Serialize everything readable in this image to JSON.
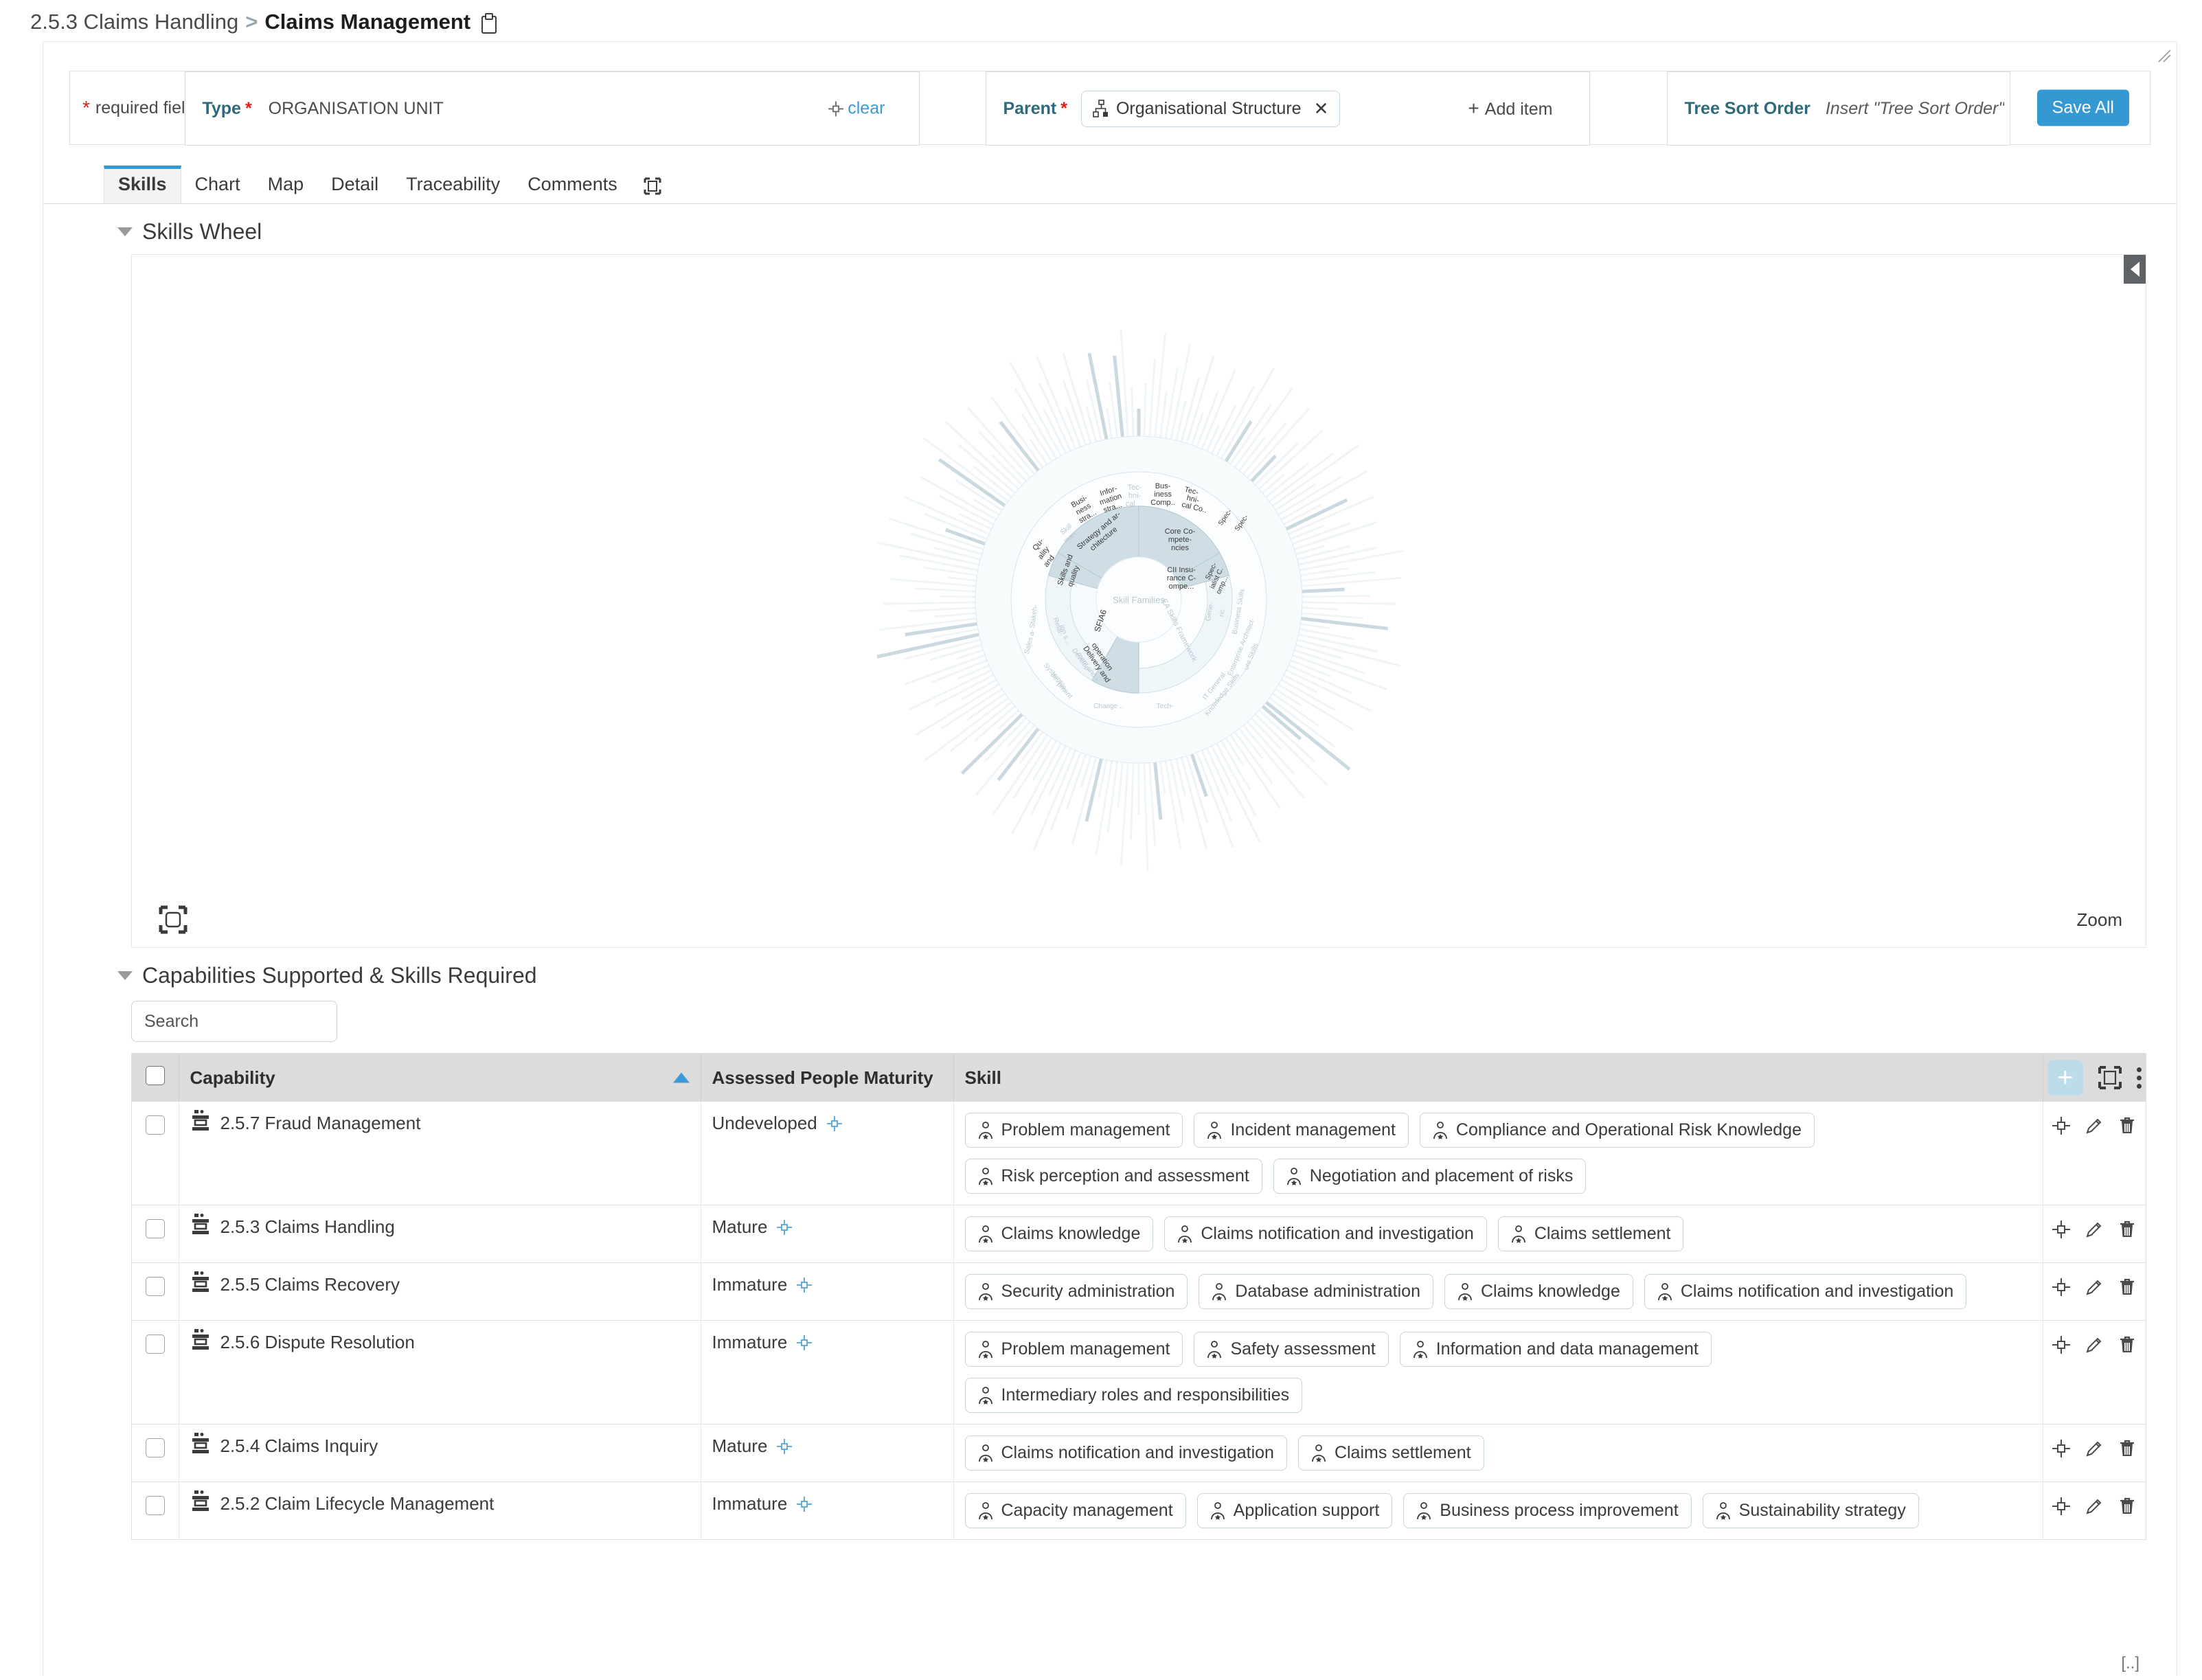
{
  "breadcrumb": {
    "parent": "2.5.3 Claims Handling",
    "separator": ">",
    "current": "Claims Management",
    "copy_icon": "clipboard-icon"
  },
  "form": {
    "required_note": "required field",
    "required_star": "*",
    "type": {
      "label": "Type",
      "star": "*",
      "value": "ORGANISATION UNIT",
      "clear_label": "clear"
    },
    "parent": {
      "label": "Parent",
      "star": "*",
      "chip": "Organisational Structure",
      "chip_remove": "✕",
      "add_item": "Add item",
      "add_plus": "+"
    },
    "tree_sort": {
      "label": "Tree Sort Order",
      "placeholder": "Insert \"Tree Sort Order\"",
      "value": ""
    },
    "save_all": "Save All"
  },
  "tabs": [
    {
      "label": "Skills",
      "active": true
    },
    {
      "label": "Chart",
      "active": false
    },
    {
      "label": "Map",
      "active": false
    },
    {
      "label": "Detail",
      "active": false
    },
    {
      "label": "Traceability",
      "active": false
    },
    {
      "label": "Comments",
      "active": false
    }
  ],
  "sections": {
    "skills_wheel": "Skills Wheel",
    "capabilities": "Capabilities Supported & Skills Required"
  },
  "wheel": {
    "center_label": "Skill Families",
    "zoom_label": "Zoom",
    "frameworks": [
      "SFIA6",
      "EA Skills Framework"
    ],
    "rings": {
      "level1": [
        "SFIA6",
        "EA Skills Framework"
      ],
      "sfia_level2": [
        "Strategy and architecture",
        "Skills and quality",
        "Delivery and operation",
        "Relations...",
        "Change a..."
      ],
      "ea_level2": [
        "Core Competencies",
        "Specialist Comp...",
        "CII Insurance Compe...",
        "Technical...",
        "Business Skills",
        "Enterprise Architecture Skills",
        "IT General Knowledge Skills",
        "Generic"
      ],
      "level3_sample": [
        "Business stra...",
        "Information stra...",
        "Technical ...",
        "Business Comp...",
        "Technical Co...",
        "Specia...",
        "Quality and ...",
        "Skill man...",
        "Systems develo-pment",
        "Development and i-mpleme...",
        "Service ...",
        "Stakeh-..."
      ]
    }
  },
  "search": {
    "placeholder": "Search",
    "value": ""
  },
  "table": {
    "columns": [
      "Capability",
      "Assessed People Maturity",
      "Skill"
    ],
    "sorted_column": "Capability",
    "sort_direction": "asc",
    "header_icons": [
      "add-icon",
      "expand-icon",
      "kebab-icon"
    ],
    "row_icons": [
      "target-icon",
      "edit-icon",
      "delete-icon"
    ],
    "rows": [
      {
        "capability": "2.5.7 Fraud Management",
        "maturity": "Undeveloped",
        "skills": [
          "Problem management",
          "Incident management",
          "Compliance and Operational Risk Knowledge",
          "Risk perception and assessment",
          "Negotiation and placement of risks"
        ]
      },
      {
        "capability": "2.5.3 Claims Handling",
        "maturity": "Mature",
        "skills": [
          "Claims knowledge",
          "Claims notification and investigation",
          "Claims settlement"
        ]
      },
      {
        "capability": "2.5.5 Claims Recovery",
        "maturity": "Immature",
        "skills": [
          "Security administration",
          "Database administration",
          "Claims knowledge",
          "Claims notification and investigation"
        ]
      },
      {
        "capability": "2.5.6 Dispute Resolution",
        "maturity": "Immature",
        "skills": [
          "Problem management",
          "Safety assessment",
          "Information and data management",
          "Intermediary roles and responsibilities"
        ]
      },
      {
        "capability": "2.5.4 Claims Inquiry",
        "maturity": "Mature",
        "skills": [
          "Claims notification and investigation",
          "Claims settlement"
        ]
      },
      {
        "capability": "2.5.2 Claim Lifecycle Management",
        "maturity": "Immature",
        "skills": [
          "Capacity management",
          "Application support",
          "Business process improvement",
          "Sustainability strategy"
        ]
      }
    ],
    "footer_ellipsis": "[..]"
  },
  "colors": {
    "accent": "#3498d2",
    "label_teal": "#2d6a7d",
    "required_red": "#e21b1b",
    "header_grey": "#dcdcdc",
    "wheel_fill": "#cfdde4"
  }
}
